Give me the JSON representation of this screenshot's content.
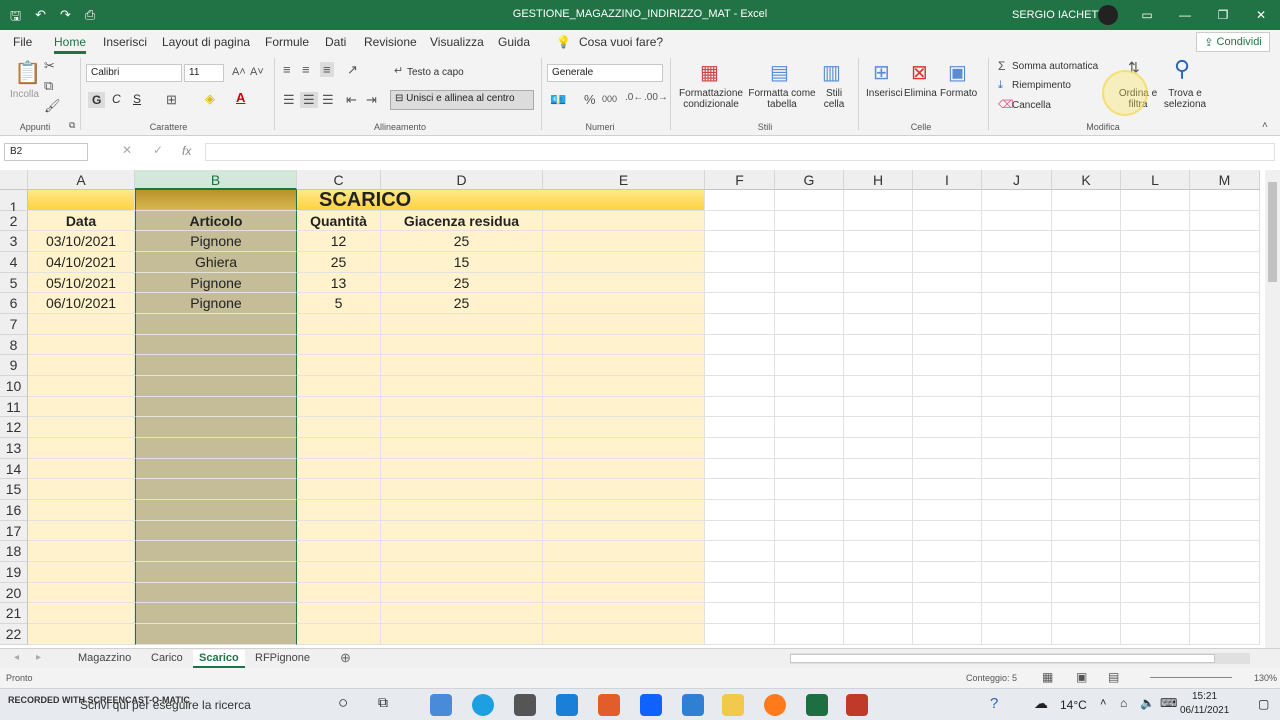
{
  "titlebar": {
    "doc_title": "GESTIONE_MAGAZZINO_INDIRIZZO_MAT  -  Excel",
    "user": "SERGIO IACHETTI"
  },
  "menu": {
    "tabs": [
      "File",
      "Home",
      "Inserisci",
      "Layout di pagina",
      "Formule",
      "Dati",
      "Revisione",
      "Visualizza",
      "Guida"
    ],
    "tell_me": "Cosa vuoi fare?",
    "share": "Condividi"
  },
  "ribbon": {
    "incolla": "Incolla",
    "appunti": "Appunti",
    "font_name": "Calibri",
    "font_size": "11",
    "bold": "G",
    "italic": "C",
    "underline": "S",
    "carattere": "Carattere",
    "testo_a_capo": "Testo a capo",
    "unisci": "Unisci e allinea al centro",
    "allineamento": "Allineamento",
    "number_format": "Generale",
    "numeri": "Numeri",
    "formattazione_cond": [
      "Formattazione",
      "condizionale"
    ],
    "formatta_tabella": [
      "Formatta come",
      "tabella"
    ],
    "stili_cella": [
      "Stili",
      "cella"
    ],
    "stili": "Stili",
    "inserisci": "Inserisci",
    "elimina": "Elimina",
    "formato": "Formato",
    "celle": "Celle",
    "somma": "Somma automatica",
    "riempimento": "Riempimento",
    "cancella": "Cancella",
    "ordina": [
      "Ordina e",
      "filtra"
    ],
    "trova": [
      "Trova e",
      "seleziona"
    ],
    "modifica": "Modifica"
  },
  "formula_bar": {
    "name_box": "B2",
    "fx": "fx",
    "content": ""
  },
  "columns": [
    "A",
    "B",
    "C",
    "D",
    "E",
    "F",
    "G",
    "H",
    "I",
    "J",
    "K",
    "L",
    "M"
  ],
  "rows": [
    "1",
    "2",
    "3",
    "4",
    "5",
    "6",
    "7",
    "8",
    "9",
    "10",
    "11",
    "12",
    "13",
    "14",
    "15",
    "16",
    "17",
    "18",
    "19",
    "20",
    "21",
    "22"
  ],
  "sheet": {
    "title": "SCARICO",
    "headers": [
      "Data",
      "Articolo",
      "Quantità",
      "Giacenza residua"
    ],
    "data": [
      [
        "03/10/2021",
        "Pignone",
        "12",
        "25"
      ],
      [
        "04/10/2021",
        "Ghiera",
        "25",
        "15"
      ],
      [
        "05/10/2021",
        "Pignone",
        "13",
        "25"
      ],
      [
        "06/10/2021",
        "Pignone",
        "5",
        "25"
      ]
    ]
  },
  "sheet_tabs": [
    "Magazzino",
    "Carico",
    "Scarico",
    "RFPignone"
  ],
  "active_tab": "Scarico",
  "status": {
    "ready": "Pronto",
    "count": "Conteggio: 5",
    "zoom": "130%"
  },
  "taskbar": {
    "search": "Scrivi qui per eseguire la ricerca",
    "temp": "14°C",
    "time": "15:21",
    "date": "06/11/2021"
  },
  "watermark": "RECORDED WITH SCREENCAST-O-MATIC",
  "colors": {
    "excel_green": "#217346",
    "header_fill": "#ffd23f",
    "data_fill": "#fff2cc",
    "articolo_fill": "#c4bd97"
  }
}
